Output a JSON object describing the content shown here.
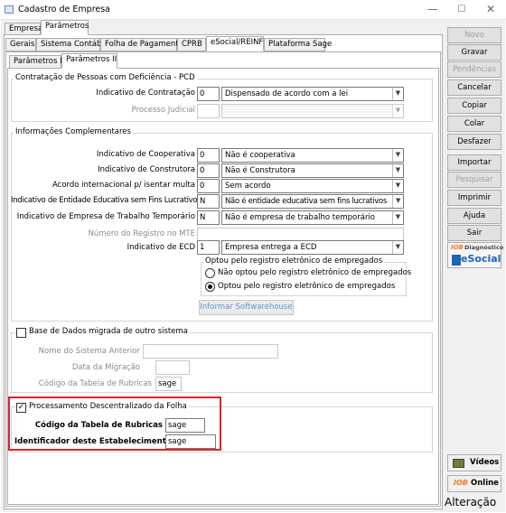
{
  "window": {
    "title": "Cadastro de Empresa"
  },
  "top_tabs": [
    "Empresa",
    "Parâmetros"
  ],
  "sub_tabs": [
    "Gerais",
    "Sistema Contábil",
    "Folha de Pagamento",
    "CPRB",
    "eSocial/REINF",
    "Plataforma Sage"
  ],
  "param_tabs": [
    "Parâmetros I",
    "Parâmetros II"
  ],
  "pcd": {
    "title": "Contratação de Pessoas com Deficiência - PCD",
    "indicativo_label": "Indicativo de Contratação",
    "indicativo_code": "0",
    "indicativo_value": "Dispensado de acordo com a lei",
    "processo_label": "Processo Judicial",
    "processo_code": "",
    "processo_value": ""
  },
  "info": {
    "title": "Informações Complementares",
    "rows": [
      {
        "label": "Indicativo de Cooperativa",
        "code": "0",
        "value": "Não é cooperativa"
      },
      {
        "label": "Indicativo de Construtora",
        "code": "0",
        "value": "Não é Construtora"
      },
      {
        "label": "Acordo internacional p/ isentar multa",
        "code": "0",
        "value": "Sem acordo"
      },
      {
        "label": "Indicativo de Entidade Educativa sem Fins Lucrativos",
        "code": "N",
        "value": "Não é entidade educativa sem fins lucrativos"
      },
      {
        "label": "Indicativo de Empresa de Trabalho Temporário",
        "code": "N",
        "value": "Não é empresa de trabalho temporário"
      }
    ],
    "mte_label": "Número do Registro no MTE",
    "mte_value": "",
    "ecd_label": "Indicativo de ECD",
    "ecd_code": "1",
    "ecd_value": "Empresa entrega a ECD",
    "registro_title": "Optou pelo registro eletrônico de empregados",
    "radio_nao": "Não optou pelo registro eletrônico de empregados",
    "radio_sim": "Optou pelo registro eletrônico de empregados",
    "informar_button": "Informar Softwarehouse"
  },
  "migrada": {
    "title": "Base de Dados migrada de outro sistema",
    "checked": false,
    "sistema_label": "Nome do Sistema Anterior",
    "sistema_value": "",
    "data_label": "Data da Migração",
    "data_value": "",
    "rubricas_label": "Código da Tabela de Rubricas",
    "rubricas_value": "sage"
  },
  "descentralizado": {
    "title": "Processamento Descentralizado da Folha",
    "checked": true,
    "rubricas_label": "Código da Tabela de Rubricas",
    "rubricas_value": "sage",
    "estab_label": "Identificador deste Estabelecimento",
    "estab_value": "sage"
  },
  "side_buttons": [
    {
      "label": "Novo",
      "enabled": false
    },
    {
      "label": "Gravar",
      "enabled": true
    },
    {
      "label": "Pendências",
      "enabled": false
    },
    {
      "label": "Cancelar",
      "enabled": true
    },
    {
      "label": "Copiar",
      "enabled": true
    },
    {
      "label": "Colar",
      "enabled": true
    },
    {
      "label": "Desfazer",
      "enabled": true
    },
    {
      "label": "Importar",
      "enabled": true
    },
    {
      "label": "Pesquisar",
      "enabled": false
    },
    {
      "label": "Imprimir",
      "enabled": true
    },
    {
      "label": "Ajuda",
      "enabled": true
    },
    {
      "label": "Sair",
      "enabled": true
    }
  ],
  "iob_diag": {
    "brand": "IOB",
    "caption": "Diagnóstico",
    "product": "eSocial"
  },
  "videos_label": "Vídeos",
  "online_label": "Online",
  "online_brand": "IOB",
  "status_text": "Alteração",
  "colors": {
    "highlight": "#d9262b",
    "esocial_blue": "#1f64b0",
    "iob_orange": "#f47a20"
  }
}
